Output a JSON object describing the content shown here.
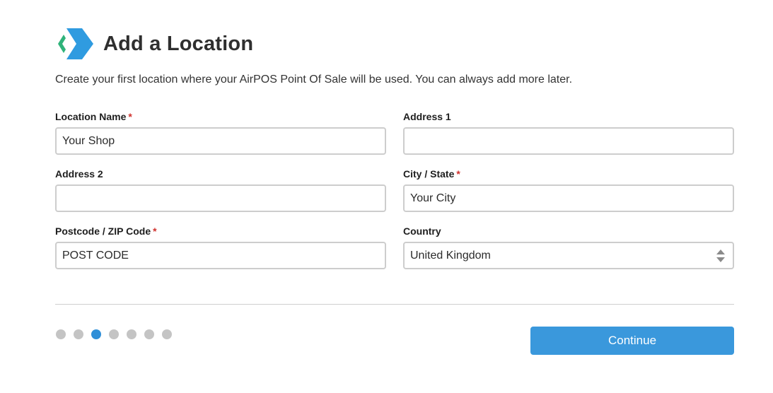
{
  "header": {
    "logo_icon": "airpos-chevron-logo-icon",
    "title": "Add a Location"
  },
  "intro": "Create your first location where your AirPOS Point Of Sale will be used. You can always add more later.",
  "form": {
    "location_name": {
      "label": "Location Name",
      "required_mark": "*",
      "value": "Your Shop"
    },
    "address1": {
      "label": "Address 1",
      "value": ""
    },
    "address2": {
      "label": "Address 2",
      "value": ""
    },
    "city_state": {
      "label": "City / State",
      "required_mark": "*",
      "value": "Your City"
    },
    "postcode": {
      "label": "Postcode / ZIP Code",
      "required_mark": "*",
      "value": "POST CODE"
    },
    "country": {
      "label": "Country",
      "selected": "United Kingdom"
    }
  },
  "progress": {
    "total_steps": 7,
    "current_step": 3
  },
  "footer": {
    "continue_label": "Continue"
  },
  "colors": {
    "accent": "#3a98dc",
    "required": "#d0312d",
    "logo_green": "#2fb37a",
    "logo_blue": "#2f9be0"
  }
}
